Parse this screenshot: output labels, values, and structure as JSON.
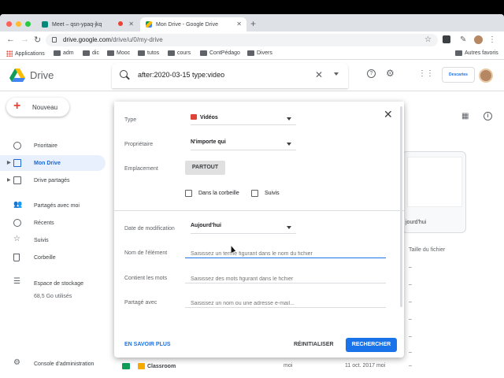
{
  "browser": {
    "tabs": [
      {
        "title": "Meet – qsn-ypaq-jkq"
      },
      {
        "title": "Mon Drive - Google Drive"
      }
    ],
    "url_host": "drive.google.com",
    "url_path": "/drive/u/0/my-drive"
  },
  "bookmarks": {
    "items": [
      "Applications",
      "adm",
      "dic",
      "Mooc",
      "tutos",
      "cours",
      "ContPédago",
      "Divers"
    ],
    "other": "Autres favoris"
  },
  "drive": {
    "app_name": "Drive",
    "search_query": "after:2020-03-15 type:video",
    "org_badge": "Descartes"
  },
  "sidebar": {
    "new_label": "Nouveau",
    "items": [
      {
        "label": "Prioritaire",
        "icon": "check-circle-icon"
      },
      {
        "label": "Mon Drive",
        "icon": "drive-folder-icon"
      },
      {
        "label": "Drive partagés",
        "icon": "shared-drive-icon"
      },
      {
        "label": "Partagés avec moi",
        "icon": "people-icon"
      },
      {
        "label": "Récents",
        "icon": "clock-icon"
      },
      {
        "label": "Suivis",
        "icon": "star-icon"
      },
      {
        "label": "Corbeille",
        "icon": "trash-icon"
      },
      {
        "label": "Espace de stockage",
        "icon": "storage-icon"
      },
      {
        "label": "Console d'administration",
        "icon": "admin-icon"
      }
    ],
    "storage_used": "68,5 Go utilisés"
  },
  "main": {
    "thumb_caption": "jourd'hui",
    "col_size": "Taille du fichier",
    "dash": "–",
    "bottom_row": {
      "name": "Classroom",
      "owner": "moi",
      "date": "11 oct. 2017 moi",
      "size": "–"
    }
  },
  "dialog": {
    "type_label": "Type",
    "type_value": "Vidéos",
    "owner_label": "Propriétaire",
    "owner_value": "N'importe qui",
    "location_label": "Emplacement",
    "location_chip": "PARTOUT",
    "in_trash": "Dans la corbeille",
    "starred": "Suivis",
    "date_label": "Date de modification",
    "date_value": "Aujourd'hui",
    "name_label": "Nom de l'élément",
    "name_placeholder": "Saisissez un terme figurant dans le nom du fichier",
    "words_label": "Contient les mots",
    "words_placeholder": "Saisissez des mots figurant dans le fichier",
    "shared_label": "Partagé avec",
    "shared_placeholder": "Saisissez un nom ou une adresse e-mail...",
    "learn_more": "EN SAVOIR PLUS",
    "reset": "RÉINITIALISER",
    "search": "RECHERCHER"
  },
  "colors": {
    "accent": "#1a73e8",
    "active_nav_bg": "#e8f0fe",
    "video_red": "#db4437"
  }
}
